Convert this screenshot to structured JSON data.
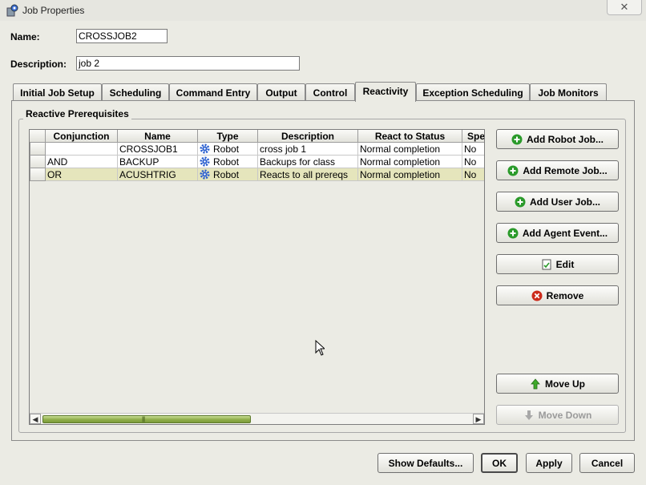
{
  "window": {
    "title": "Job Properties",
    "close_label": "✕"
  },
  "form": {
    "name_label": "Name:",
    "name_value": "CROSSJOB2",
    "description_label": "Description:",
    "description_value": "job 2"
  },
  "tabs": [
    {
      "label": "Initial Job Setup",
      "active": false
    },
    {
      "label": "Scheduling",
      "active": false
    },
    {
      "label": "Command Entry",
      "active": false
    },
    {
      "label": "Output",
      "active": false
    },
    {
      "label": "Control",
      "active": false
    },
    {
      "label": "Reactivity",
      "active": true
    },
    {
      "label": "Exception Scheduling",
      "active": false
    },
    {
      "label": "Job Monitors",
      "active": false
    }
  ],
  "group_title": "Reactive Prerequisites",
  "table": {
    "columns": [
      "Conjunction",
      "Name",
      "Type",
      "Description",
      "React to Status",
      "Spe"
    ],
    "rows": [
      {
        "conjunction": "",
        "name": "CROSSJOB1",
        "type": "Robot",
        "description": "cross job 1",
        "status": "Normal completion",
        "spe": "No"
      },
      {
        "conjunction": "AND",
        "name": "BACKUP",
        "type": "Robot",
        "description": "Backups for class",
        "status": "Normal completion",
        "spe": "No"
      },
      {
        "conjunction": "OR",
        "name": "ACUSHTRIG",
        "type": "Robot",
        "description": "Reacts to all prereqs",
        "status": "Normal completion",
        "spe": "No"
      }
    ],
    "selected_row": 2
  },
  "side_buttons": {
    "add_robot_job": "Add Robot Job...",
    "add_remote_job": "Add Remote Job...",
    "add_user_job": "Add User Job...",
    "add_agent_event": "Add Agent Event...",
    "edit": "Edit",
    "remove": "Remove",
    "move_up": "Move Up",
    "move_down": "Move Down"
  },
  "footer": {
    "show_defaults": "Show Defaults...",
    "ok": "OK",
    "apply": "Apply",
    "cancel": "Cancel"
  },
  "colors": {
    "background": "#ebebe4",
    "selected_row": "#e5e5bc",
    "add_icon": "#2a9a2a",
    "remove_icon": "#cc2a1a",
    "scroll_thumb": "#8fae4a",
    "gear_icon": "#2a5fcf"
  }
}
